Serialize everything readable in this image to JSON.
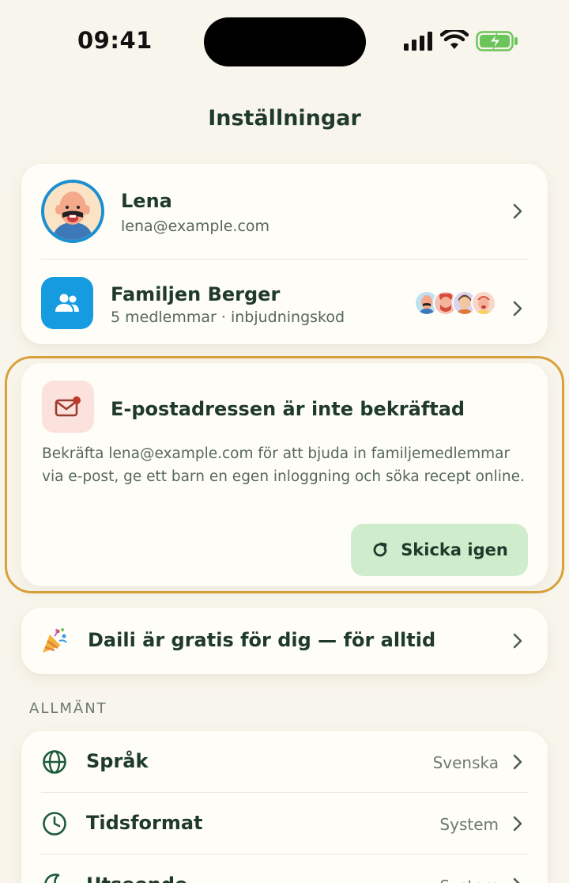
{
  "status_bar": {
    "time": "09:41"
  },
  "page": {
    "title": "Inställningar"
  },
  "profile": {
    "name": "Lena",
    "email": "lena@example.com"
  },
  "family": {
    "name": "Familjen Berger",
    "subtitle": "5 medlemmar · inbjudningskod",
    "member_count_shown": 4
  },
  "verify_email": {
    "title": "E-postadressen är inte bekräftad",
    "body": "Bekräfta lena@example.com för att bjuda in familjemedlemmar via e-post, ge ett barn en egen inloggning och söka recept online.",
    "button_label": "Skicka igen"
  },
  "promo": {
    "label": "Daili är gratis för dig — för alltid"
  },
  "general": {
    "header": "ALLMÄNT",
    "items": [
      {
        "label": "Språk",
        "value": "Svenska",
        "icon": "globe-icon"
      },
      {
        "label": "Tidsformat",
        "value": "System",
        "icon": "clock-icon"
      },
      {
        "label": "Utseende",
        "value": "System",
        "icon": "moon-icon"
      }
    ]
  },
  "colors": {
    "background": "#f8f5ec",
    "accent_blue": "#179be0",
    "warning_border": "#d9a03c",
    "button_green": "#cfeccc",
    "text_primary": "#1f3a2c"
  }
}
